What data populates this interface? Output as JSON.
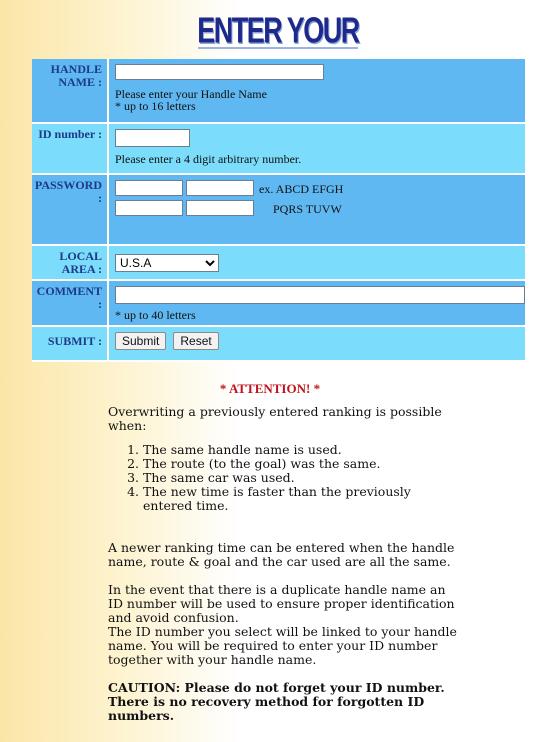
{
  "header": {
    "title": "ENTER YOUR RECORD"
  },
  "form": {
    "handle": {
      "label": "HANDLE NAME :",
      "hint1": "Please enter your Handle Name",
      "hint2": "* up to 16 letters",
      "value": ""
    },
    "id": {
      "label": "ID number :",
      "hint": "Please enter a 4 digit arbitrary number.",
      "value": ""
    },
    "password": {
      "label": "PASSWORD :",
      "example1": "ex. ABCD EFGH",
      "example2": "PQRS TUVW",
      "values": [
        "",
        "",
        "",
        ""
      ]
    },
    "area": {
      "label": "LOCAL AREA :",
      "selected": "U.S.A"
    },
    "comment": {
      "label": "COMMENT :",
      "hint": "* up to 40 letters",
      "value": ""
    },
    "submit": {
      "label": "SUBMIT :",
      "submit_button": "Submit",
      "reset_button": "Reset"
    }
  },
  "colors": {
    "row_blue": "#5fb8f1",
    "row_cyan": "#7bdcfb",
    "label_text": "#1e3a8a",
    "attention": "#c0121b"
  },
  "attention": {
    "title": "* ATTENTION!  *"
  },
  "notes": {
    "intro": "Overwriting a previously entered ranking is possible when:",
    "conditions": [
      "The same handle name is used.",
      "The route (to the goal) was the same.",
      "The same car was used.",
      "The new time is faster than the previously entered time."
    ],
    "p1": "A newer ranking time can be entered when the handle name, route & goal and the car used are all the same.",
    "p2": "In the event that there is a duplicate handle name an ID number will be used to ensure proper identification and avoid confusion.",
    "p3": "The ID number you select will be linked to your handle name. You will be required to enter your ID number together with your handle name.",
    "caution": "CAUTION: Please do not forget your ID number. There is no recovery method for forgotten ID numbers."
  }
}
